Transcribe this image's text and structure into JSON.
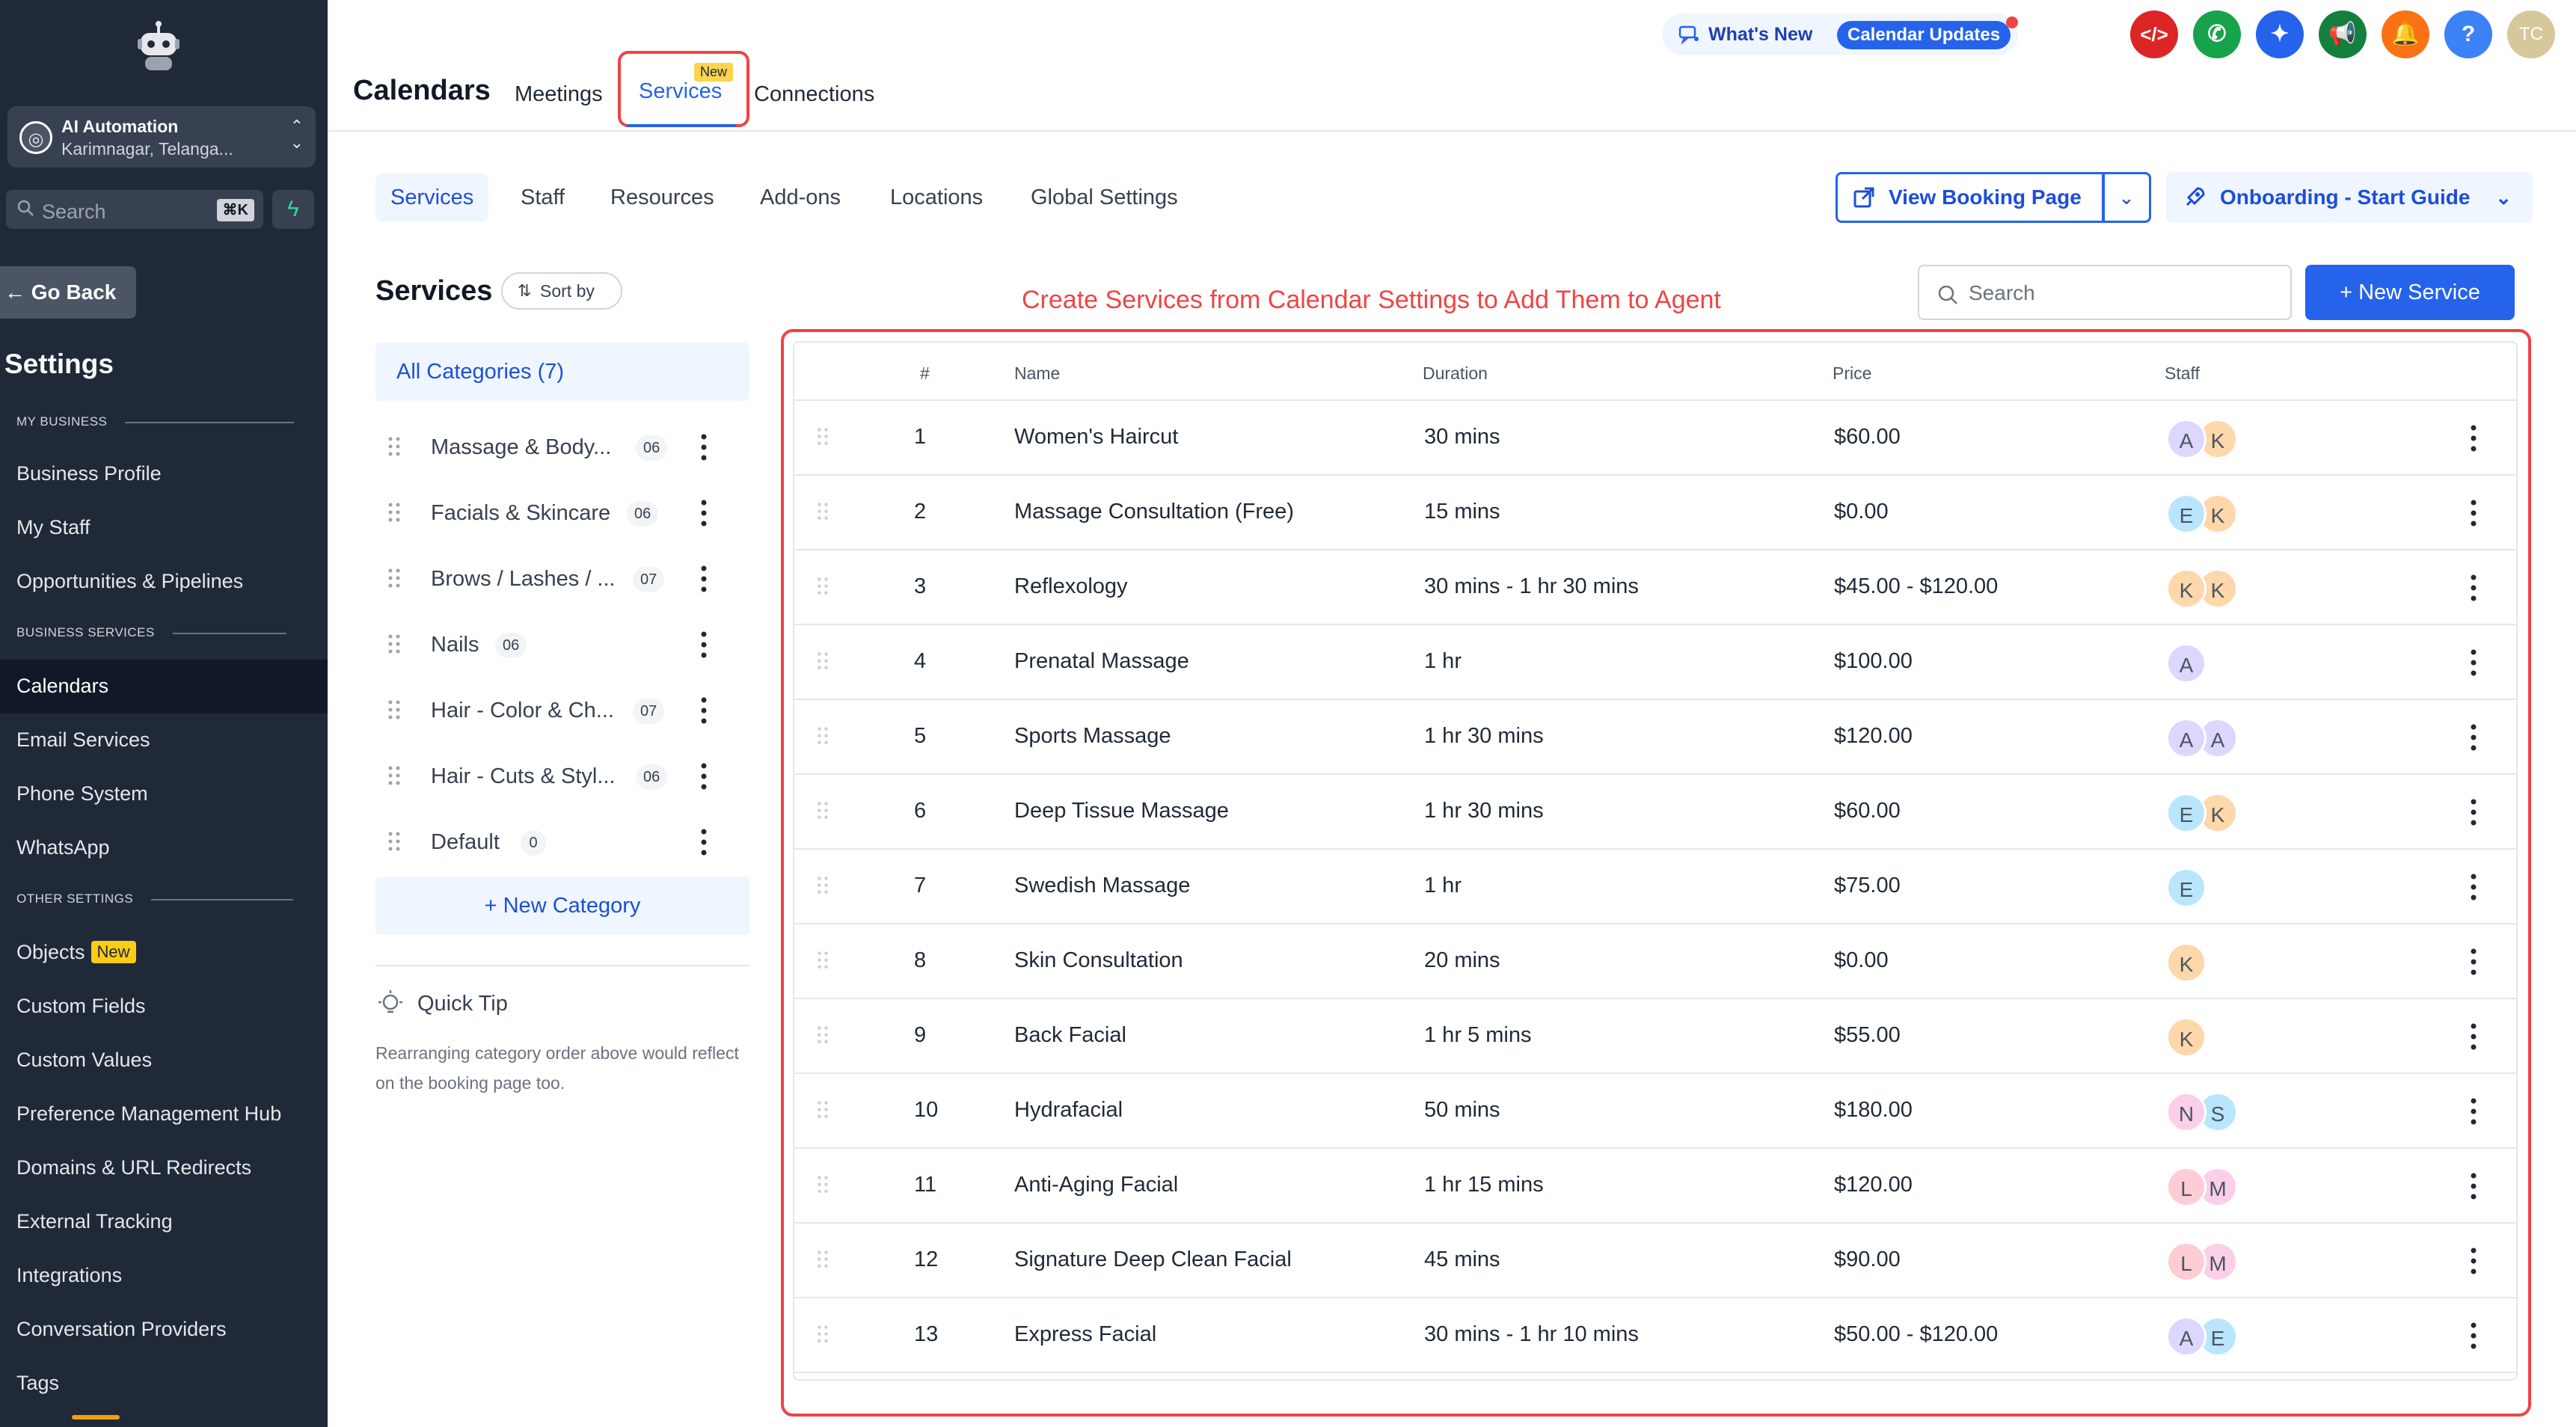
{
  "sidebar": {
    "account": {
      "name": "AI Automation",
      "location": "Karimnagar, Telanga..."
    },
    "search": {
      "placeholder": "Search",
      "shortcut": "⌘K"
    },
    "go_back": "Go Back",
    "title": "Settings",
    "sections": {
      "my_business": "MY BUSINESS",
      "business_services": "BUSINESS SERVICES",
      "other_settings": "OTHER SETTINGS"
    },
    "items": {
      "business_profile": "Business Profile",
      "my_staff": "My Staff",
      "opportunities": "Opportunities & Pipelines",
      "calendars": "Calendars",
      "email_services": "Email Services",
      "phone_system": "Phone System",
      "whatsapp": "WhatsApp",
      "objects": "Objects",
      "objects_badge": "New",
      "custom_fields": "Custom Fields",
      "custom_values": "Custom Values",
      "preference_hub": "Preference Management Hub",
      "domains": "Domains & URL Redirects",
      "external_tracking": "External Tracking",
      "integrations": "Integrations",
      "conversation_providers": "Conversation Providers",
      "tags": "Tags"
    }
  },
  "header": {
    "title": "Calendars",
    "tabs": {
      "meetings": "Meetings",
      "services": "Services",
      "services_badge": "New",
      "connections": "Connections"
    },
    "whats_new": "What's New",
    "calendar_updates": "Calendar Updates",
    "user_initials": "TC",
    "help": "?"
  },
  "subtabs": {
    "services": "Services",
    "staff": "Staff",
    "resources": "Resources",
    "addons": "Add-ons",
    "locations": "Locations",
    "global_settings": "Global Settings"
  },
  "actions": {
    "view_booking_page": "View Booking Page",
    "onboarding": "Onboarding - Start Guide",
    "search_placeholder": "Search",
    "new_service": "+ New Service"
  },
  "left": {
    "title": "Services",
    "sort_by": "Sort by",
    "all_categories": "All Categories (7)",
    "categories": [
      {
        "name": "Massage & Body...",
        "count": "06"
      },
      {
        "name": "Facials & Skincare",
        "count": "06"
      },
      {
        "name": "Brows / Lashes / ...",
        "count": "07"
      },
      {
        "name": "Nails",
        "count": "06"
      },
      {
        "name": "Hair - Color & Ch...",
        "count": "07"
      },
      {
        "name": "Hair - Cuts & Styl...",
        "count": "06"
      },
      {
        "name": "Default",
        "count": "0"
      }
    ],
    "new_category": "+ New Category",
    "quick_tip_title": "Quick Tip",
    "quick_tip_text": "Rearranging category order above would reflect on the booking page too."
  },
  "annotation": "Create Services from Calendar Settings to Add Them to Agent",
  "table": {
    "headers": {
      "num": "#",
      "name": "Name",
      "duration": "Duration",
      "price": "Price",
      "staff": "Staff"
    },
    "rows": [
      {
        "num": "1",
        "name": "Women's Haircut",
        "duration": "30 mins",
        "price": "$60.00",
        "staff": [
          "A",
          "K"
        ]
      },
      {
        "num": "2",
        "name": "Massage Consultation (Free)",
        "duration": "15 mins",
        "price": "$0.00",
        "staff": [
          "E",
          "K"
        ]
      },
      {
        "num": "3",
        "name": "Reflexology",
        "duration": "30 mins - 1 hr 30 mins",
        "price": "$45.00 - $120.00",
        "staff": [
          "K",
          "K"
        ]
      },
      {
        "num": "4",
        "name": "Prenatal Massage",
        "duration": "1 hr",
        "price": "$100.00",
        "staff": [
          "A"
        ]
      },
      {
        "num": "5",
        "name": "Sports Massage",
        "duration": "1 hr 30 mins",
        "price": "$120.00",
        "staff": [
          "A",
          "A"
        ]
      },
      {
        "num": "6",
        "name": "Deep Tissue Massage",
        "duration": "1 hr 30 mins",
        "price": "$60.00",
        "staff": [
          "E",
          "K"
        ]
      },
      {
        "num": "7",
        "name": "Swedish Massage",
        "duration": "1 hr",
        "price": "$75.00",
        "staff": [
          "E"
        ]
      },
      {
        "num": "8",
        "name": "Skin Consultation",
        "duration": "20 mins",
        "price": "$0.00",
        "staff": [
          "K"
        ]
      },
      {
        "num": "9",
        "name": "Back Facial",
        "duration": "1 hr 5 mins",
        "price": "$55.00",
        "staff": [
          "K"
        ]
      },
      {
        "num": "10",
        "name": "Hydrafacial",
        "duration": "50 mins",
        "price": "$180.00",
        "staff": [
          "N",
          "S"
        ]
      },
      {
        "num": "11",
        "name": "Anti-Aging Facial",
        "duration": "1 hr 15 mins",
        "price": "$120.00",
        "staff": [
          "L",
          "M"
        ]
      },
      {
        "num": "12",
        "name": "Signature Deep Clean Facial",
        "duration": "45 mins",
        "price": "$90.00",
        "staff": [
          "L",
          "M"
        ]
      },
      {
        "num": "13",
        "name": "Express Facial",
        "duration": "30 mins - 1 hr 10 mins",
        "price": "$50.00 - $120.00",
        "staff": [
          "A",
          "E"
        ]
      }
    ]
  },
  "avatar_colors": {
    "A": "#ddd6fe",
    "K": "#fed7aa",
    "E": "#bae6fd",
    "N": "#fbcfe8",
    "S": "#bae6fd",
    "L": "#fecdd3",
    "M": "#fbcfe8"
  },
  "colors": {
    "accent": "#2563eb",
    "annotation": "#ef4444",
    "sidebar": "#1f2937"
  }
}
